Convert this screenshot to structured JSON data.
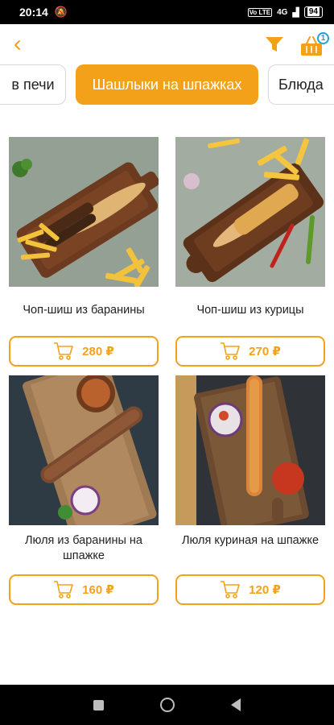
{
  "status_bar": {
    "time": "20:14",
    "network": "4G",
    "battery": "94"
  },
  "header": {
    "back_icon": "chevron-left-icon",
    "filter_icon": "filter-icon",
    "cart_icon": "basket-icon",
    "cart_count": "1"
  },
  "tabs": [
    {
      "label": "в печи",
      "active": false
    },
    {
      "label": "Шашлыки на шпажках",
      "active": true
    },
    {
      "label": "Блюда",
      "active": false
    }
  ],
  "products": [
    {
      "name": "Чоп-шиш из баранины",
      "price": "280 ₽"
    },
    {
      "name": "Чоп-шиш из курицы",
      "price": "270 ₽"
    },
    {
      "name": "Люля из баранины на шпажке",
      "price": "160 ₽"
    },
    {
      "name": "Люля куриная на шпажке",
      "price": "120 ₽"
    }
  ],
  "colors": {
    "accent": "#f4a11a",
    "badge": "#1aa3d9"
  }
}
